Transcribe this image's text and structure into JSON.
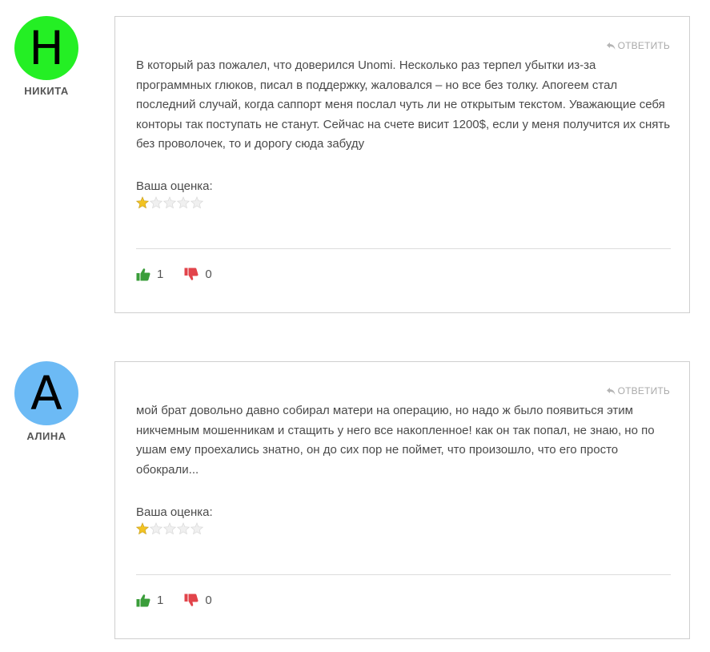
{
  "colors": {
    "avatar_green": "#24ef24",
    "avatar_blue": "#6cbaf5",
    "thumb_up": "#3a9d3a",
    "thumb_down": "#e2444b",
    "star_filled": "#f2c322",
    "star_empty": "#e9e9e9"
  },
  "icons": {
    "reply": "reply-arrow-icon",
    "like": "thumbs-up-icon",
    "dislike": "thumbs-down-icon",
    "star": "star-icon"
  },
  "comments": [
    {
      "avatar_letter": "H",
      "author": "НИКИТА",
      "reply_label": "ОТВЕТИТЬ",
      "text": "В который раз пожалел, что доверился Unomi. Несколько раз терпел убытки из-за программных глюков, писал в поддержку, жаловался – но все без толку. Апогеем стал последний случай, когда саппорт меня послал чуть ли не открытым текстом. Уважающие себя конторы так поступать не станут. Сейчас на счете висит 1200$, если у меня получится их снять без проволочек, то и дорогу сюда забуду",
      "rating_label": "Ваша оценка:",
      "rating": 1,
      "rating_max": 5,
      "likes": "1",
      "dislikes": "0"
    },
    {
      "avatar_letter": "A",
      "author": "АЛИНА",
      "reply_label": "ОТВЕТИТЬ",
      "text": "мой брат довольно давно собирал матери на операцию, но надо ж было появиться этим никчемным мошенникам и стащить у него все накопленное! как он так попал, не знаю, но по ушам ему проехались знатно, он до сих пор не поймет, что произошло, что его просто обокрали...",
      "rating_label": "Ваша оценка:",
      "rating": 1,
      "rating_max": 5,
      "likes": "1",
      "dislikes": "0"
    }
  ]
}
